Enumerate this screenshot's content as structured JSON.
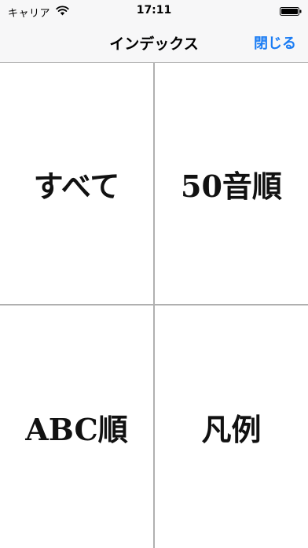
{
  "status_bar": {
    "carrier": "キャリア",
    "time": "17:11",
    "icons": [
      "wifi-icon",
      "battery-icon"
    ]
  },
  "nav_bar": {
    "title": "インデックス",
    "close_label": "閉じる",
    "accent_color": "#1a7cf4"
  },
  "index_grid": {
    "items": [
      {
        "label": "すべて"
      },
      {
        "label": "50音順"
      },
      {
        "label": "ABC順"
      },
      {
        "label": "凡例"
      }
    ]
  }
}
